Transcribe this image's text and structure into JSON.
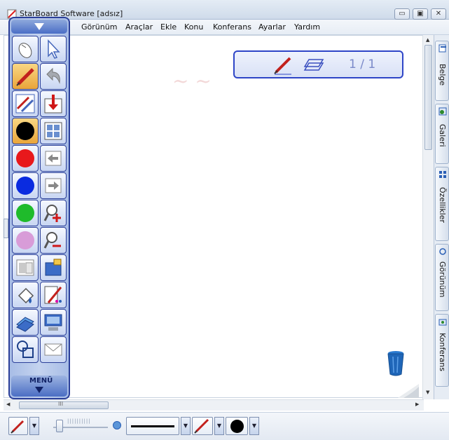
{
  "window": {
    "title": "StarBoard Software [adsız]",
    "buttons": {
      "minimize": "▭",
      "maximize": "▣",
      "close": "✕"
    }
  },
  "menubar": {
    "items": [
      "Görünüm",
      "Araçlar",
      "Ekle",
      "Konu",
      "Konferans",
      "Ayarlar",
      "Yardım"
    ]
  },
  "page_indicator": {
    "label": "1 / 1",
    "icons": [
      "pen-icon",
      "page-icon"
    ]
  },
  "side_tabs": {
    "items": [
      {
        "label": "Belge",
        "icon": "document-icon"
      },
      {
        "label": "Galeri",
        "icon": "gallery-icon"
      },
      {
        "label": "Özellikler",
        "icon": "properties-icon"
      },
      {
        "label": "Görünüm",
        "icon": "view-icon"
      },
      {
        "label": "Konferans",
        "icon": "conference-icon"
      }
    ]
  },
  "toolbox": {
    "menu_label": "MENÜ",
    "colors": {
      "black": "#000000",
      "red": "#e8181c",
      "blue": "#0a2be0",
      "green": "#1fbb2b",
      "pink": "#d89cd8",
      "active": "#f2c062",
      "frame": "#2b3f99"
    },
    "tools_left": [
      "mouse-icon",
      "pen-icon",
      "multi-pen-icon",
      "color-black",
      "color-red",
      "color-blue",
      "color-green",
      "color-pink",
      "eraser-icon",
      "fill-icon",
      "shapes-icon",
      "objects-icon"
    ],
    "tools_right": [
      "pointer-icon",
      "undo-icon",
      "import-icon",
      "layout-icon",
      "previous-page-icon",
      "next-page-icon",
      "zoom-in-icon",
      "zoom-out-icon",
      "tools-icon",
      "edit-icon",
      "screen-icon",
      "mail-icon"
    ]
  },
  "scrollbars": {
    "h_label": "III"
  },
  "bottombar": {
    "slider_marks": "||||||||||",
    "dropdown_arrow": "▼"
  }
}
